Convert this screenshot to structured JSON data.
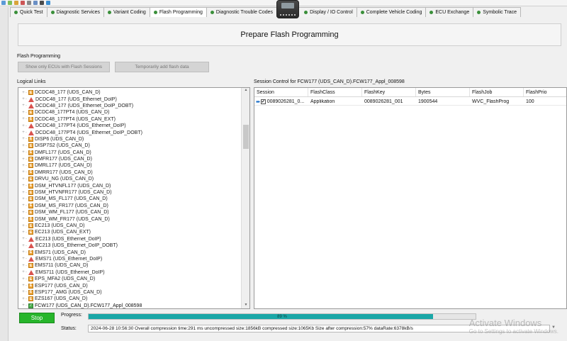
{
  "tabs": [
    {
      "label": "Quick Test"
    },
    {
      "label": "Diagnostic Services"
    },
    {
      "label": "Variant Coding"
    },
    {
      "label": "Flash Programming",
      "active": true
    },
    {
      "label": "Diagnostic Trouble Codes"
    },
    {
      "label": "Display / IO Control"
    },
    {
      "label": "Complete Vehicle Coding"
    },
    {
      "label": "ECU Exchange"
    },
    {
      "label": "Symbolic Trace"
    }
  ],
  "header": {
    "title": "Prepare Flash Programming"
  },
  "flash": {
    "section_title": "Flash Programming",
    "show_ecus_label": "Show only ECUs with Flash Sessions",
    "temp_add_label": "Temporarily add flash data"
  },
  "logical_links": {
    "title": "Logical Links",
    "items": [
      {
        "label": "DCDC48_177 (UDS_CAN_D)",
        "icon": "ecu"
      },
      {
        "label": "DCDC48_177 (UDS_Ethernet_DoIP)",
        "icon": "warn"
      },
      {
        "label": "DCDC48_177 (UDS_Ethernet_DoIP_DOBT)",
        "icon": "warn"
      },
      {
        "label": "DCDC48_177PT4 (UDS_CAN_D)",
        "icon": "ecu"
      },
      {
        "label": "DCDC48_177PT4 (UDS_CAN_EXT)",
        "icon": "ecu"
      },
      {
        "label": "DCDC48_177PT4 (UDS_Ethernet_DoIP)",
        "icon": "warn"
      },
      {
        "label": "DCDC48_177PT4 (UDS_Ethernet_DoIP_DOBT)",
        "icon": "warn"
      },
      {
        "label": "DISP6 (UDS_CAN_D)",
        "icon": "ecu"
      },
      {
        "label": "DISP7S2 (UDS_CAN_D)",
        "icon": "ecu"
      },
      {
        "label": "DMFL177 (UDS_CAN_D)",
        "icon": "ecu"
      },
      {
        "label": "DMFR177 (UDS_CAN_D)",
        "icon": "ecu"
      },
      {
        "label": "DMRL177 (UDS_CAN_D)",
        "icon": "ecu"
      },
      {
        "label": "DMRR177 (UDS_CAN_D)",
        "icon": "ecu"
      },
      {
        "label": "DRVU_NG (UDS_CAN_D)",
        "icon": "ecu"
      },
      {
        "label": "DSM_HTVNFL177 (UDS_CAN_D)",
        "icon": "ecu"
      },
      {
        "label": "DSM_HTVNFR177 (UDS_CAN_D)",
        "icon": "ecu"
      },
      {
        "label": "DSM_MS_FL177 (UDS_CAN_D)",
        "icon": "ecu"
      },
      {
        "label": "DSM_MS_FR177 (UDS_CAN_D)",
        "icon": "ecu"
      },
      {
        "label": "DSM_WM_FL177 (UDS_CAN_D)",
        "icon": "ecu"
      },
      {
        "label": "DSM_WM_FR177 (UDS_CAN_D)",
        "icon": "ecu"
      },
      {
        "label": "EC213 (UDS_CAN_D)",
        "icon": "ecu"
      },
      {
        "label": "EC213 (UDS_CAN_EXT)",
        "icon": "ecu"
      },
      {
        "label": "EC213 (UDS_Ethernet_DoIP)",
        "icon": "warn"
      },
      {
        "label": "EC213 (UDS_Ethernet_DoIP_DOBT)",
        "icon": "warn"
      },
      {
        "label": "EMS71 (UDS_CAN_D)",
        "icon": "ecu"
      },
      {
        "label": "EMS71 (UDS_Ethernet_DoIP)",
        "icon": "warn"
      },
      {
        "label": "EMS711 (UDS_CAN_D)",
        "icon": "ecu"
      },
      {
        "label": "EMS711 (UDS_Ethernet_DoIP)",
        "icon": "warn"
      },
      {
        "label": "EPS_MFA2 (UDS_CAN_D)",
        "icon": "ecu"
      },
      {
        "label": "ESP177 (UDS_CAN_D)",
        "icon": "ecu"
      },
      {
        "label": "ESP177_AMG (UDS_CAN_D)",
        "icon": "ecu"
      },
      {
        "label": "EZS167 (UDS_CAN_D)",
        "icon": "ecu"
      },
      {
        "label": "FCW177 (UDS_CAN_D).FCW177_Appl_008598",
        "icon": "ok",
        "selected": true
      }
    ]
  },
  "session": {
    "title": "Session Control for FCW177 (UDS_CAN_D).FCW177_Appl_008598",
    "columns": [
      "Session",
      "FlashClass",
      "FlashKey",
      "Bytes",
      "FlashJob",
      "FlashPrio"
    ],
    "rows": [
      {
        "session": "0089026281_0...",
        "flash_class": "Applikation",
        "flash_key": "0089026281_001",
        "bytes": "1900544",
        "flash_job": "WVC_FlashProg",
        "flash_prio": "100"
      }
    ]
  },
  "controls": {
    "stop_label": "Stop",
    "progress_label": "Progress:",
    "progress_text": "89 %",
    "progress_value": 0.89,
    "status_label": "Status:",
    "status_text": "2024-06-28 10:56:30 Overall compression time:291 ms uncompressed size:1856kB compressed size:1065Kb Size after compression:57% dataRate:6378kB/s"
  },
  "watermark": {
    "line1": "Activate Windows",
    "line2": "Go to Settings to activate Windows."
  },
  "colors": {
    "stop_green": "#27b52b",
    "progress_teal": "#1aa7a7"
  }
}
